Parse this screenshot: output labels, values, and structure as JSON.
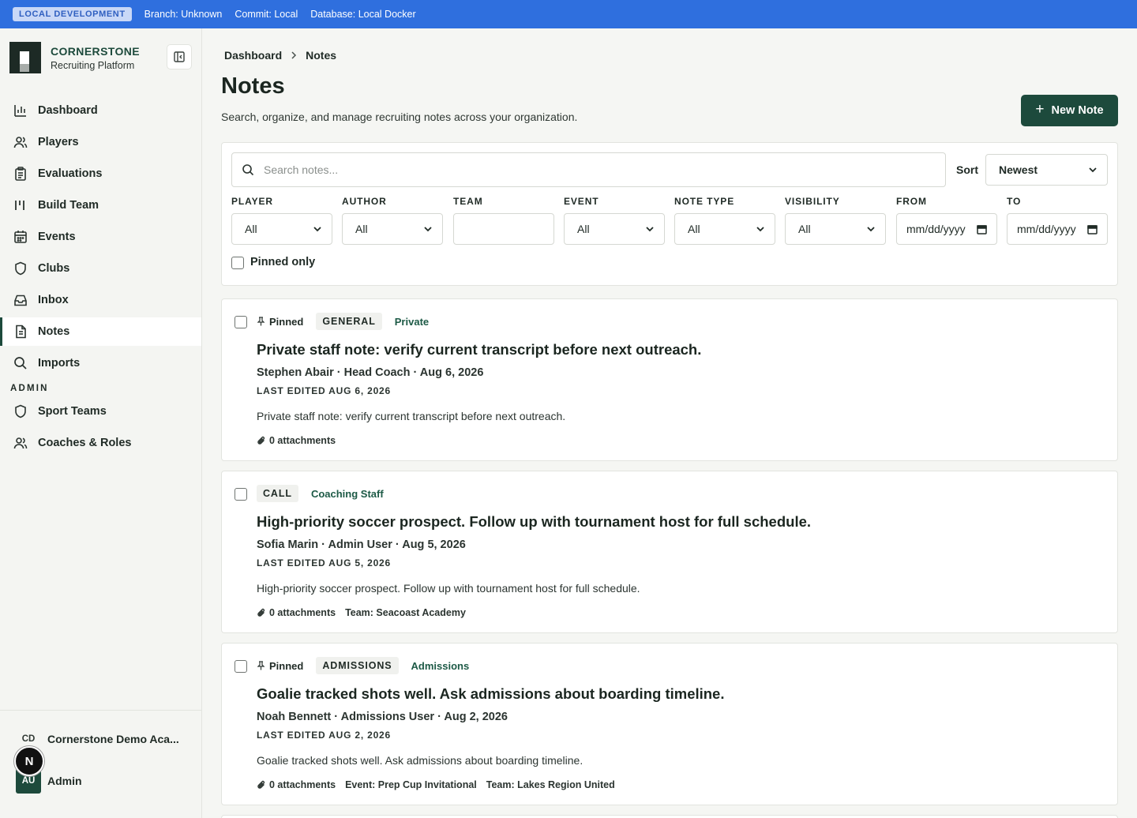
{
  "env": {
    "badge": "LOCAL DEVELOPMENT",
    "branch": "Branch: Unknown",
    "commit": "Commit: Local",
    "database": "Database: Local Docker"
  },
  "brand": {
    "name": "CORNERSTONE",
    "subtitle": "Recruiting Platform"
  },
  "nav": {
    "items": [
      {
        "label": "Dashboard",
        "icon": "bar-chart-icon"
      },
      {
        "label": "Players",
        "icon": "users-icon"
      },
      {
        "label": "Evaluations",
        "icon": "clipboard-icon"
      },
      {
        "label": "Build Team",
        "icon": "columns-icon"
      },
      {
        "label": "Events",
        "icon": "calendar-icon"
      },
      {
        "label": "Clubs",
        "icon": "shield-icon"
      },
      {
        "label": "Inbox",
        "icon": "inbox-icon"
      },
      {
        "label": "Notes",
        "icon": "file-text-icon",
        "active": true
      },
      {
        "label": "Imports",
        "icon": "search-icon"
      }
    ],
    "admin_label": "ADMIN",
    "admin_items": [
      {
        "label": "Sport Teams",
        "icon": "shield-icon"
      },
      {
        "label": "Coaches & Roles",
        "icon": "users-icon"
      }
    ]
  },
  "footer": {
    "org_abbr": "CD",
    "org_name": "Cornerstone Demo Aca...",
    "n_badge": "N",
    "user_abbr": "AU",
    "user_name": "Admin"
  },
  "breadcrumb": {
    "root": "Dashboard",
    "current": "Notes"
  },
  "page": {
    "title": "Notes",
    "subtitle": "Search, organize, and manage recruiting notes across your organization.",
    "new_note_label": "New Note"
  },
  "filters": {
    "search_placeholder": "Search notes...",
    "sort_label": "Sort",
    "sort_value": "Newest",
    "groups": [
      {
        "label": "PLAYER",
        "value": "All"
      },
      {
        "label": "AUTHOR",
        "value": "All"
      },
      {
        "label": "TEAM",
        "value": ""
      },
      {
        "label": "EVENT",
        "value": "All"
      },
      {
        "label": "NOTE TYPE",
        "value": "All"
      },
      {
        "label": "VISIBILITY",
        "value": "All"
      },
      {
        "label": "FROM",
        "value": "mm/dd/yyyy"
      },
      {
        "label": "TO",
        "value": "mm/dd/yyyy"
      }
    ],
    "pinned_only_label": "Pinned only"
  },
  "notes": [
    {
      "pinned": "Pinned",
      "type": "GENERAL",
      "visibility": "Private",
      "title": "Private staff note: verify current transcript before next outreach.",
      "meta": "Stephen Abair · Head Coach · Aug 6, 2026",
      "edited": "LAST EDITED AUG 6, 2026",
      "body": "Private staff note: verify current transcript before next outreach.",
      "attachments": "0 attachments",
      "tags": []
    },
    {
      "pinned": "",
      "type": "CALL",
      "visibility": "Coaching Staff",
      "title": "High-priority soccer prospect. Follow up with tournament host for full schedule.",
      "meta": "Sofia Marin · Admin User · Aug 5, 2026",
      "edited": "LAST EDITED AUG 5, 2026",
      "body": "High-priority soccer prospect. Follow up with tournament host for full schedule.",
      "attachments": "0 attachments",
      "tags": [
        "Team: Seacoast Academy"
      ]
    },
    {
      "pinned": "Pinned",
      "type": "ADMISSIONS",
      "visibility": "Admissions",
      "title": "Goalie tracked shots well. Ask admissions about boarding timeline.",
      "meta": "Noah Bennett · Admissions User · Aug 2, 2026",
      "edited": "LAST EDITED AUG 2, 2026",
      "body": "Goalie tracked shots well. Ask admissions about boarding timeline.",
      "attachments": "0 attachments",
      "tags": [
        "Event: Prep Cup Invitational",
        "Team: Lakes Region United"
      ]
    }
  ]
}
